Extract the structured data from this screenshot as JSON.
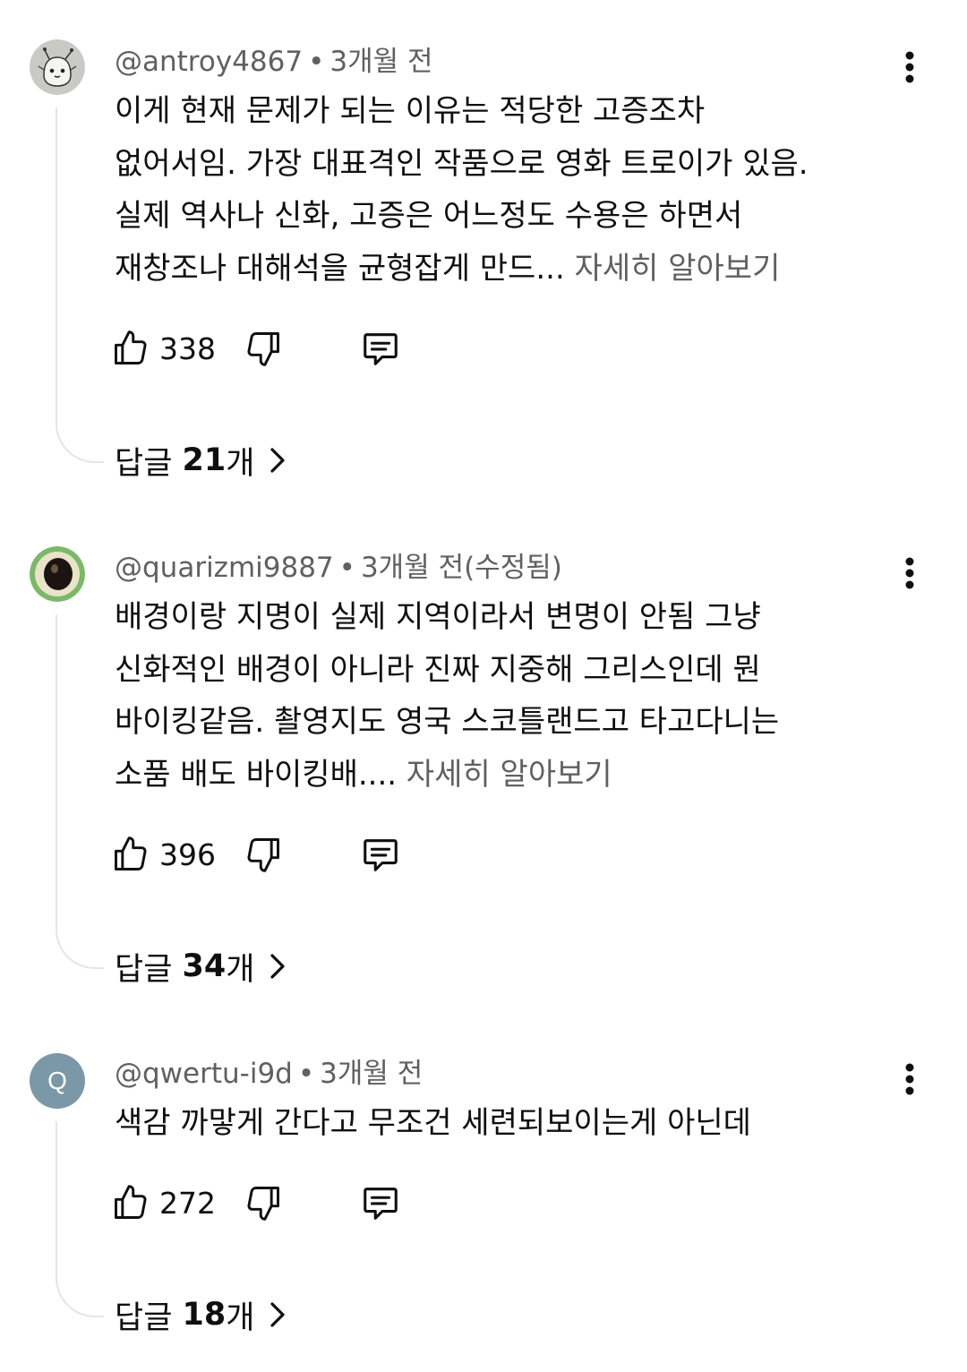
{
  "comments": [
    {
      "handle": "@antroy4867",
      "time": "3개월 전",
      "lines": [
        "이게 현재 문제가 되는 이유는 적당한 고증조차",
        "없어서임. 가장 대표격인 작품으로 영화 트로이가 있음.",
        "실제 역사나 신화, 고증은 어느정도 수용은 하면서",
        "재창조나 대해석을 균형잡게 만드..."
      ],
      "read_more": "자세히 알아보기",
      "likes": "338",
      "replies_label": "답글",
      "replies_count": "21",
      "replies_unit": "개",
      "avatar": "cartoon-creature-avatar"
    },
    {
      "handle": "@quarizmi9887",
      "time": "3개월 전(수정됨)",
      "lines": [
        "배경이랑 지명이 실제 지역이라서 변명이 안됨 그냥",
        "신화적인 배경이 아니라 진짜 지중해 그리스인데 뭔",
        "바이킹같음. 촬영지도 영국 스코틀랜드고 타고다니는",
        "소품 배도 바이킹배...."
      ],
      "read_more": "자세히 알아보기",
      "likes": "396",
      "replies_label": "답글",
      "replies_count": "34",
      "replies_unit": "개",
      "avatar": "green-eye-avatar"
    },
    {
      "handle": "@qwertu-i9d",
      "time": "3개월 전",
      "lines": [
        "색감 까맣게 간다고 무조건 세련되보이는게 아닌데"
      ],
      "read_more": "",
      "likes": "272",
      "replies_label": "답글",
      "replies_count": "18",
      "replies_unit": "개",
      "avatar_letter": "Q",
      "avatar_color": "#7a98a7"
    }
  ],
  "icons": {
    "like": "thumbs-up-icon",
    "dislike": "thumbs-down-icon",
    "reply": "comment-icon",
    "more": "more-vertical-icon",
    "replies_arrow": "chevron-right-icon"
  },
  "colors": {
    "text": "#0f0f0f",
    "secondary": "#606060",
    "thread_line": "#e5e5e5"
  }
}
